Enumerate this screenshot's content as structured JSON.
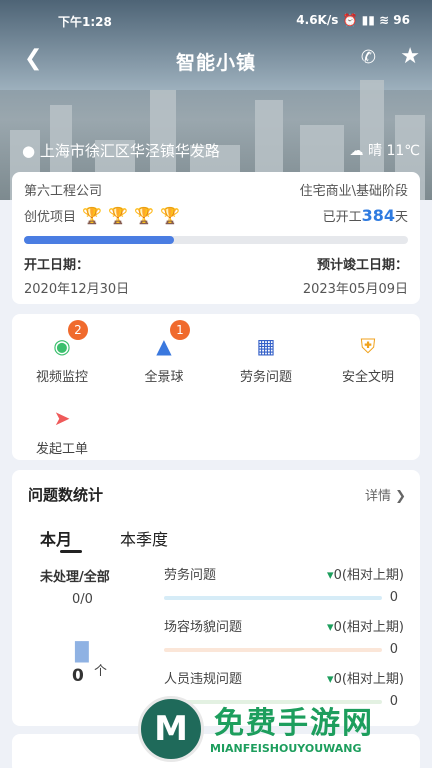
{
  "status": {
    "time": "下午1:28",
    "right": "4.6K/s ⏰ ▮▮ ≋ 96"
  },
  "header": {
    "title": "智能小镇"
  },
  "location": {
    "address": "上海市徐汇区华泾镇华发路",
    "weather": "晴 11℃"
  },
  "project": {
    "company": "第六工程公司",
    "stage": "住宅商业\\基础阶段",
    "label": "创优项目",
    "started_prefix": "已开工",
    "days": "384",
    "days_suffix": "天",
    "progress": 0.39,
    "start_label": "开工日期：",
    "end_label": "预计竣工日期：",
    "start_date": "2020年12月30日",
    "end_date": "2023年05月09日"
  },
  "menu": [
    {
      "label": "视频监控",
      "badge": "2"
    },
    {
      "label": "全景球",
      "badge": "1"
    },
    {
      "label": "劳务问题",
      "badge": ""
    },
    {
      "label": "安全文明",
      "badge": ""
    },
    {
      "label": "发起工单",
      "badge": ""
    }
  ],
  "stats": {
    "title": "问题数统计",
    "more": "详情",
    "tabs": [
      "本月",
      "本季度"
    ],
    "unprocessed_label": "未处理/全部",
    "unprocessed_value": "0/0",
    "count": "0",
    "count_unit": "个",
    "items": [
      {
        "label": "劳务问题",
        "delta": "0(相对上期)",
        "value": "0",
        "color": "#d6ecf7"
      },
      {
        "label": "场容场貌问题",
        "delta": "0(相对上期)",
        "value": "0",
        "color": "#fbe6d8"
      },
      {
        "label": "人员违规问题",
        "delta": "0(相对上期)",
        "value": "0",
        "color": "#e3f1e2"
      }
    ]
  },
  "watermark": {
    "title": "免费手游网",
    "subtitle": "MIANFEISHOUYOUWANG"
  }
}
